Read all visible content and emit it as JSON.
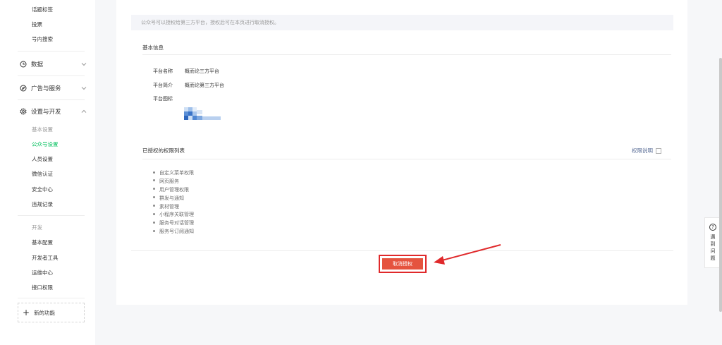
{
  "sidebar": {
    "top_items": [
      {
        "label": "话题标签"
      },
      {
        "label": "投票"
      },
      {
        "label": "号内搜索"
      }
    ],
    "groups": [
      {
        "label": "数据",
        "icon": "clock-icon",
        "expanded": false
      },
      {
        "label": "广告与服务",
        "icon": "compass-icon",
        "expanded": false
      },
      {
        "label": "设置与开发",
        "icon": "gear-icon",
        "expanded": true
      }
    ],
    "settings_section_label": "基本设置",
    "settings_items": [
      {
        "label": "公众号设置",
        "active": true
      },
      {
        "label": "人员设置"
      },
      {
        "label": "微信认证"
      },
      {
        "label": "安全中心"
      },
      {
        "label": "违规记录"
      }
    ],
    "dev_section_label": "开发",
    "dev_items": [
      {
        "label": "基本配置"
      },
      {
        "label": "开发者工具"
      },
      {
        "label": "运维中心"
      },
      {
        "label": "接口权限"
      }
    ],
    "new_feature_label": "新的功能",
    "active_color": "#07c160"
  },
  "main": {
    "notice": "公众号可以授权给第三方平台，授权后可在本页进行取消授权。",
    "basic_info": {
      "title": "基本信息",
      "name_label": "平台名称",
      "name_value": "概而论三方平台",
      "intro_label": "平台简介",
      "intro_value": "概而论第三方平台",
      "icon_label": "平台图标"
    },
    "permissions": {
      "title": "已授权的权限列表",
      "help_label": "权限说明",
      "items": [
        "自定义菜单权限",
        "网页服务",
        "用户管理权限",
        "群发与通知",
        "素材管理",
        "小程序关联管理",
        "服务号对话管理",
        "服务号订阅通知"
      ]
    },
    "cancel_button": "取消授权",
    "button_color": "#e5533e",
    "highlight_color": "#e0292b"
  },
  "help_float": {
    "label": "遇到问题"
  }
}
